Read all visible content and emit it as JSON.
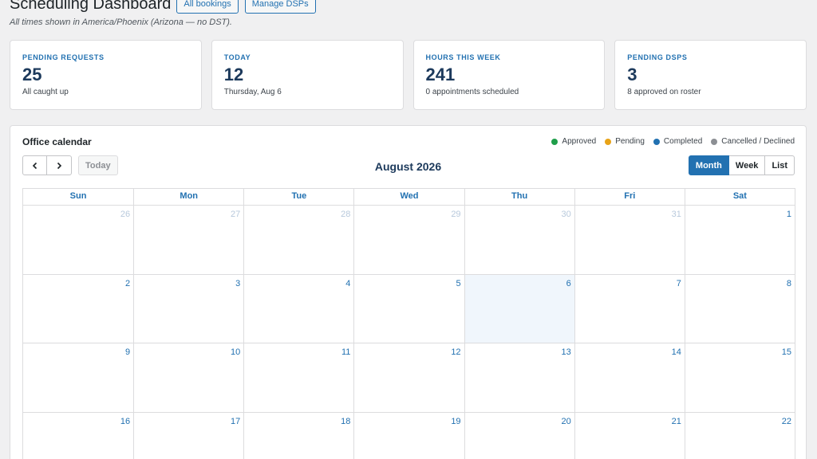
{
  "header": {
    "title": "Scheduling Dashboard",
    "buttons": [
      "All bookings",
      "Manage DSPs"
    ],
    "tz_note": "All times shown in America/Phoenix (Arizona — no DST)."
  },
  "cards": [
    {
      "label": "PENDING REQUESTS",
      "value": "25",
      "sub": "All caught up"
    },
    {
      "label": "TODAY",
      "value": "12",
      "sub": "Thursday, Aug 6"
    },
    {
      "label": "HOURS THIS WEEK",
      "value": "241",
      "sub": "0 appointments scheduled"
    },
    {
      "label": "PENDING DSPS",
      "value": "3",
      "sub": "8 approved on roster"
    }
  ],
  "calendar": {
    "title": "Office calendar",
    "legend": [
      {
        "label": "Approved",
        "color": "#1f9e4a"
      },
      {
        "label": "Pending",
        "color": "#e8a317"
      },
      {
        "label": "Completed",
        "color": "#2271b1"
      },
      {
        "label": "Cancelled / Declined",
        "color": "#8c8f94"
      }
    ],
    "nav": {
      "prev_icon": "chevron-left-icon",
      "next_icon": "chevron-right-icon",
      "today_label": "Today"
    },
    "month_label": "August 2026",
    "views": [
      "Month",
      "Week",
      "List"
    ],
    "active_view": "Month",
    "weekdays": [
      "Sun",
      "Mon",
      "Tue",
      "Wed",
      "Thu",
      "Fri",
      "Sat"
    ],
    "weeks": [
      [
        {
          "d": "26",
          "other": true
        },
        {
          "d": "27",
          "other": true
        },
        {
          "d": "28",
          "other": true
        },
        {
          "d": "29",
          "other": true
        },
        {
          "d": "30",
          "other": true
        },
        {
          "d": "31",
          "other": true
        },
        {
          "d": "1"
        }
      ],
      [
        {
          "d": "2"
        },
        {
          "d": "3"
        },
        {
          "d": "4"
        },
        {
          "d": "5"
        },
        {
          "d": "6",
          "today": true
        },
        {
          "d": "7"
        },
        {
          "d": "8"
        }
      ],
      [
        {
          "d": "9"
        },
        {
          "d": "10"
        },
        {
          "d": "11"
        },
        {
          "d": "12"
        },
        {
          "d": "13"
        },
        {
          "d": "14"
        },
        {
          "d": "15"
        }
      ],
      [
        {
          "d": "16"
        },
        {
          "d": "17"
        },
        {
          "d": "18"
        },
        {
          "d": "19"
        },
        {
          "d": "20"
        },
        {
          "d": "21"
        },
        {
          "d": "22"
        }
      ]
    ]
  }
}
